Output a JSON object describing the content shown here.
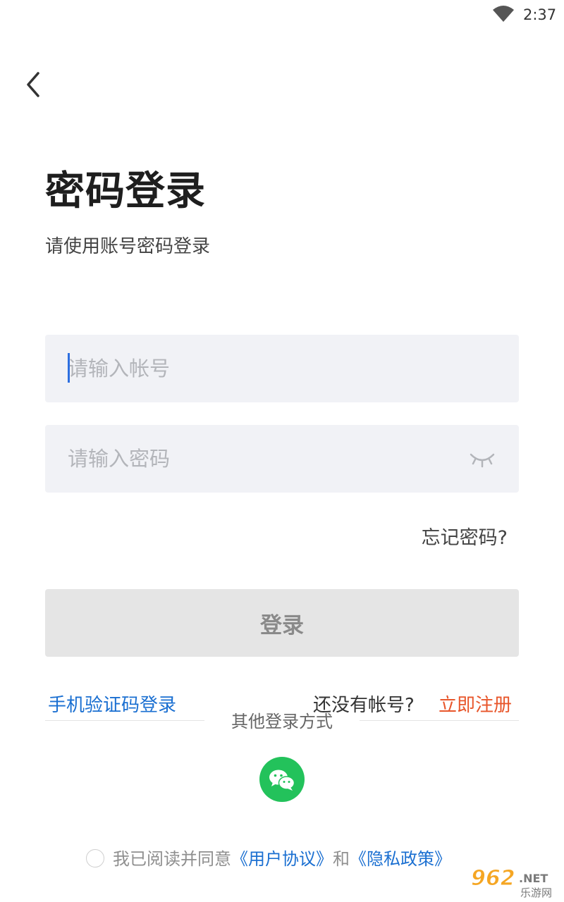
{
  "status_bar": {
    "time": "2:37",
    "wifi_icon": "wifi-icon"
  },
  "nav": {
    "back_icon": "chevron-left-icon"
  },
  "header": {
    "title": "密码登录",
    "subtitle": "请使用账号密码登录"
  },
  "form": {
    "account_placeholder": "请输入帐号",
    "account_value": "",
    "password_placeholder": "请输入密码",
    "password_value": "",
    "password_toggle_icon": "eye-closed-icon",
    "forgot_password": "忘记密码?",
    "login_button": "登录"
  },
  "links": {
    "sms_login": "手机验证码登录",
    "no_account": "还没有帐号?",
    "register": "立即注册"
  },
  "other_login": {
    "label": "其他登录方式",
    "wechat_icon": "wechat-icon"
  },
  "agreement": {
    "prefix": "我已阅读并同意",
    "user_agreement": "《用户协议》",
    "and": "和",
    "privacy_policy": "《隐私政策》"
  },
  "watermark": {
    "number": "962",
    "net": ".NET",
    "site": "乐游网"
  },
  "colors": {
    "link_blue": "#1a6fd1",
    "register_orange": "#e8562b",
    "wechat_green": "#23c25b",
    "field_bg": "#f1f2f6",
    "button_disabled_bg": "#e5e5e5",
    "cursor_blue": "#2d6fe0"
  }
}
